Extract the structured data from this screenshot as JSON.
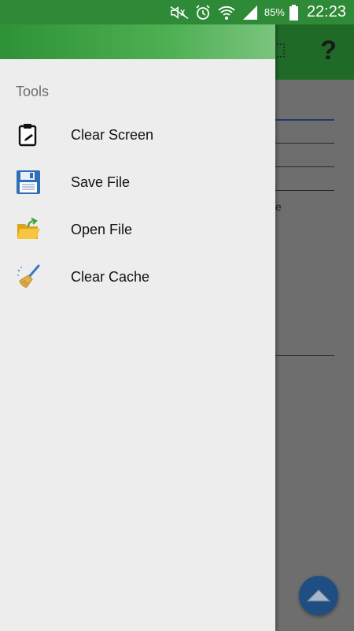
{
  "status_bar": {
    "battery_percent": "85%",
    "time": "22:23",
    "icons": [
      "mute-icon",
      "alarm-icon",
      "wifi-icon",
      "signal-icon",
      "battery-icon"
    ]
  },
  "background_screen": {
    "toolbar_icons": [
      "chip-icon",
      "help-icon"
    ],
    "help_glyph": "?",
    "partial_text": "e"
  },
  "drawer": {
    "section_title": "Tools",
    "items": [
      {
        "label": "Clear Screen",
        "icon": "clipboard-icon"
      },
      {
        "label": "Save File",
        "icon": "floppy-disk-icon"
      },
      {
        "label": "Open File",
        "icon": "open-folder-icon"
      },
      {
        "label": "Clear Cache",
        "icon": "broom-icon"
      }
    ]
  },
  "colors": {
    "status_bar": "#2e8a36",
    "drawer_background": "#ededed",
    "fab": "#1f4f82"
  }
}
